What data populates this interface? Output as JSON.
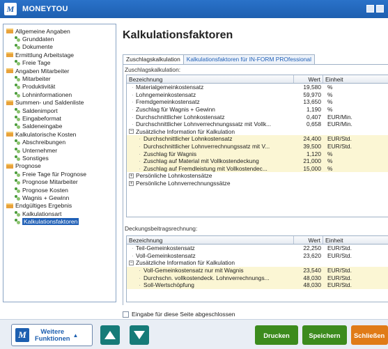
{
  "window": {
    "title": "MONEYTOU",
    "logo_letter": "M"
  },
  "sidebar": {
    "items": [
      {
        "label": "Allgemeine Angaben",
        "level": 0
      },
      {
        "label": "Grunddaten",
        "level": 1
      },
      {
        "label": "Dokumente",
        "level": 1
      },
      {
        "label": "Ermittlung Arbeitstage",
        "level": 0
      },
      {
        "label": "Freie Tage",
        "level": 1
      },
      {
        "label": "Angaben Mitarbeiter",
        "level": 0
      },
      {
        "label": "Mitarbeiter",
        "level": 1
      },
      {
        "label": "Produktivität",
        "level": 1
      },
      {
        "label": "Lohninformationen",
        "level": 1
      },
      {
        "label": "Summen- und Saldenliste",
        "level": 0
      },
      {
        "label": "Saldenimport",
        "level": 1
      },
      {
        "label": "Eingabeformat",
        "level": 1
      },
      {
        "label": "Saldeneingabe",
        "level": 1
      },
      {
        "label": "Kalkulatorische Kosten",
        "level": 0
      },
      {
        "label": "Abschreibungen",
        "level": 1
      },
      {
        "label": "Unternehmer",
        "level": 1
      },
      {
        "label": "Sonstiges",
        "level": 1
      },
      {
        "label": "Prognose",
        "level": 0
      },
      {
        "label": "Freie Tage für Prognose",
        "level": 1
      },
      {
        "label": "Prognose Mitarbeiter",
        "level": 1
      },
      {
        "label": "Prognose Kosten",
        "level": 1
      },
      {
        "label": "Wagnis + Gewinn",
        "level": 1
      },
      {
        "label": "Endgültiges Ergebnis",
        "level": 0
      },
      {
        "label": "Kalkulationsart",
        "level": 1
      },
      {
        "label": "Kalkulationsfaktoren",
        "level": 1,
        "selected": true
      }
    ]
  },
  "main": {
    "title": "Kalkulationsfaktoren",
    "tabs": [
      "Zuschlagskalkulation",
      "Kalkulationsfaktoren für IN-FORM PROfessional"
    ],
    "section1_label": "Zuschlagskalkulation:",
    "section2_label": "Deckungsbeitragsrechnung:",
    "columns": {
      "name": "Bezeichnung",
      "value": "Wert",
      "unit": "Einheit"
    },
    "grid1": {
      "rows": [
        {
          "name": "Materialgemeinkostensatz",
          "value": "19,580",
          "unit": "%"
        },
        {
          "name": "Lohngemeinkostensatz",
          "value": "59,970",
          "unit": "%"
        },
        {
          "name": "Fremdgemeinkostensatz",
          "value": "13,650",
          "unit": "%"
        },
        {
          "name": "Zuschlag für Wagnis + Gewinn",
          "value": "1,190",
          "unit": "%"
        },
        {
          "name": "Durchschnittlicher Lohnkostensatz",
          "value": "0,407",
          "unit": "EUR/Min."
        },
        {
          "name": "Durchschnittlicher Lohnverrechnungssatz mit Vollk...",
          "value": "0,658",
          "unit": "EUR/Min."
        }
      ],
      "group_label": "Zusätzliche Information für Kalkulation",
      "group_rows": [
        {
          "name": "Durchschnittlicher Lohnkostensatz",
          "value": "24,400",
          "unit": "EUR/Std."
        },
        {
          "name": "Durchschnittlicher Lohnverrechnungssatz mit V...",
          "value": "39,500",
          "unit": "EUR/Std."
        },
        {
          "name": "Zuschlag für Wagnis",
          "value": "1,120",
          "unit": "%"
        },
        {
          "name": "Zuschlag auf Material mit Vollkostendeckung",
          "value": "21,000",
          "unit": "%"
        },
        {
          "name": "Zuschlag auf Fremdleistung mit Vollkostendec...",
          "value": "15,000",
          "unit": "%"
        }
      ],
      "collapsed_groups": [
        "Persönliche Lohnkostensätze",
        "Persönliche Lohnverrechnungssätze"
      ]
    },
    "grid2": {
      "rows": [
        {
          "name": "Teil-Gemeinkostensatz",
          "value": "22,250",
          "unit": "EUR/Std."
        },
        {
          "name": "Voll-Gemeinkostensatz",
          "value": "23,620",
          "unit": "EUR/Std."
        }
      ],
      "group_label": "Zusätzliche Information für Kalkulation",
      "group_rows": [
        {
          "name": "Voll-Gemeinkostensatz nur mit Wagnis",
          "value": "23,540",
          "unit": "EUR/Std."
        },
        {
          "name": "Durchschn. vollkostendeck. Lohnverrechnungs...",
          "value": "48,030",
          "unit": "EUR/Std."
        },
        {
          "name": "Soll-Wertschöpfung",
          "value": "48,030",
          "unit": "EUR/Std."
        }
      ]
    },
    "checkbox_label": "Eingabe für diese Seite abgeschlossen"
  },
  "footer": {
    "more_line1": "Weitere",
    "more_line2": "Funktionen",
    "print": "Drucken",
    "save": "Speichern",
    "close": "Schließen"
  },
  "colors": {
    "titlebar": "#1d5fb0",
    "nav": "#167b78",
    "green": "#3c8b1d",
    "orange": "#e07b17",
    "highlight": "#fbf6d4"
  }
}
